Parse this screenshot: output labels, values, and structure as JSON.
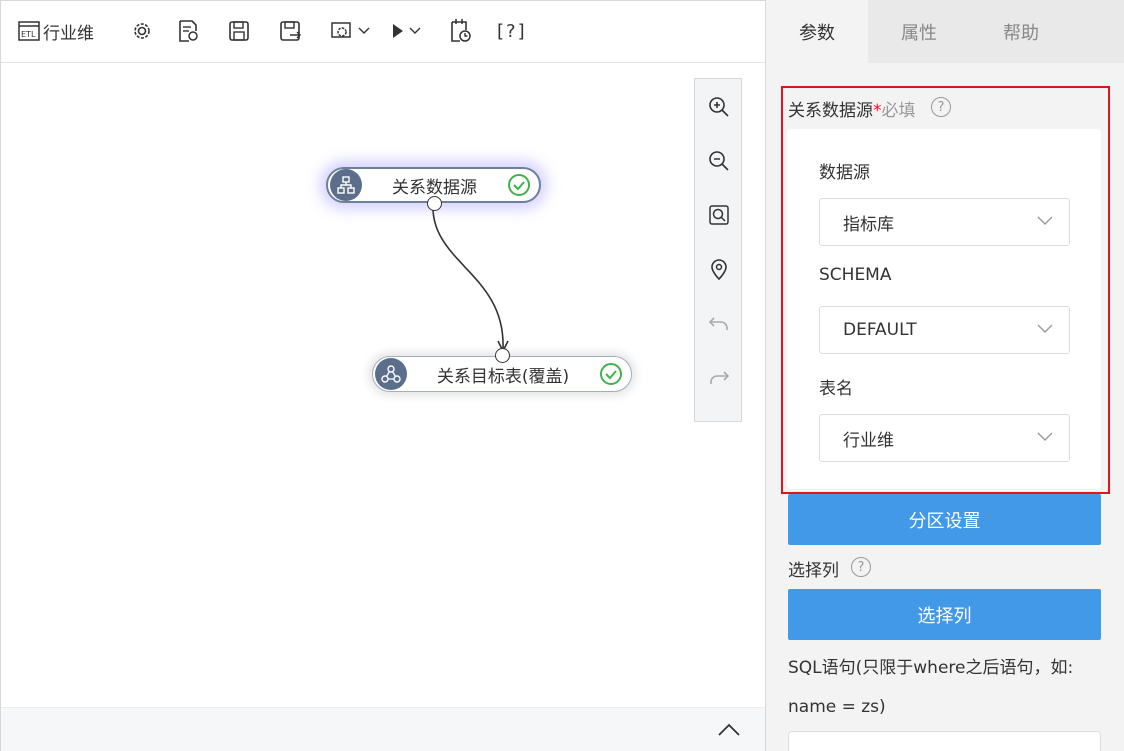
{
  "toolbar": {
    "title": "行业维",
    "icons": [
      "etl-icon",
      "gear-icon",
      "edit-doc-icon",
      "save-icon",
      "save-as-icon",
      "settings-dropdown-icon",
      "run-icon",
      "schedule-icon",
      "help-bracket-icon"
    ],
    "help_label": "[?]"
  },
  "canvas": {
    "nodes": [
      {
        "label": "关系数据源",
        "status": "success"
      },
      {
        "label": "关系目标表(覆盖)",
        "status": "success"
      }
    ],
    "zoom_tools": [
      "zoom-in-icon",
      "zoom-out-icon",
      "fit-view-icon",
      "locate-icon",
      "undo-icon",
      "redo-icon"
    ]
  },
  "panel": {
    "tabs": [
      {
        "label": "参数",
        "active": true
      },
      {
        "label": "属性",
        "active": false
      },
      {
        "label": "帮助",
        "active": false
      }
    ],
    "source_section": {
      "title": "关系数据源",
      "required": "*必填"
    },
    "fields": [
      {
        "label": "数据源",
        "value": "指标库"
      },
      {
        "label": "SCHEMA",
        "value": "DEFAULT"
      },
      {
        "label": "表名",
        "value": "行业维"
      }
    ],
    "partition_button": "分区设置",
    "select_columns_label": "选择列",
    "select_columns_button": "选择列",
    "sql_label": "SQL语句(只限于where之后语句，如:",
    "sql_example": "name = zs)"
  },
  "colors": {
    "accent_blue": "#4299e8",
    "highlight_red": "#e0141d",
    "success_green": "#3fb24b",
    "node_icon_bg": "#5b6f8c"
  }
}
